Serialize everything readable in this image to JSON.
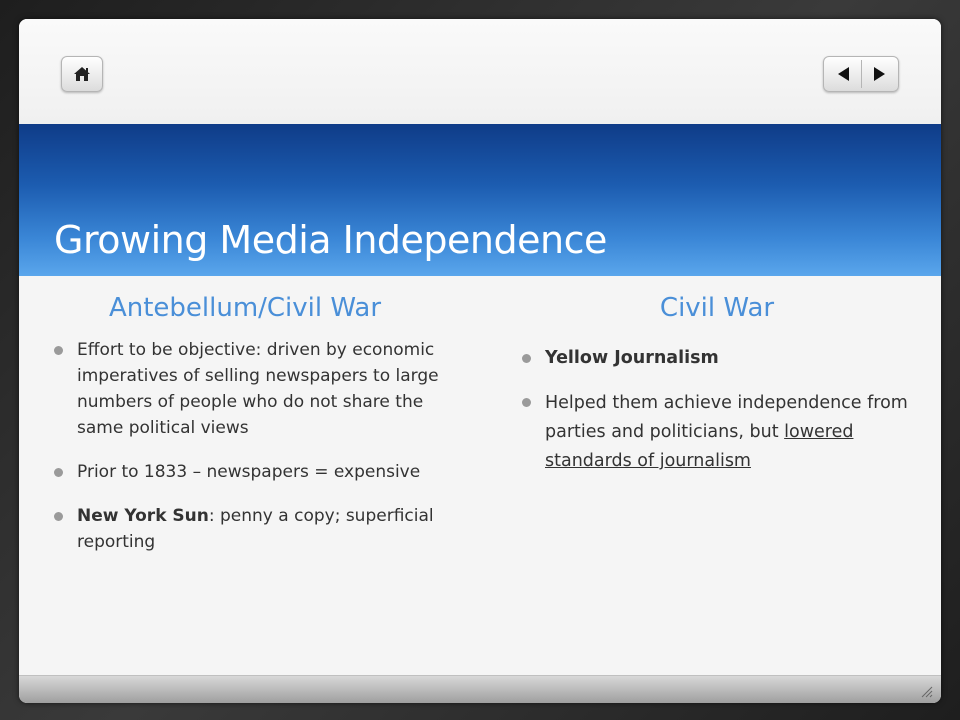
{
  "slide": {
    "title": "Growing Media Independence"
  },
  "nav": {
    "home_icon": "home-icon",
    "prev_icon": "triangle-left-icon",
    "next_icon": "triangle-right-icon"
  },
  "left_column": {
    "heading": "Antebellum/Civil War",
    "bullets": [
      {
        "text": "Effort to be objective: driven by economic imperatives of selling newspapers to large numbers of people who do not share the same political views"
      },
      {
        "text": "Prior to 1833 – newspapers = expensive"
      },
      {
        "bold": "New York Sun",
        "text": ": penny a copy; superficial reporting"
      }
    ]
  },
  "right_column": {
    "heading": "Civil War",
    "bullets": [
      {
        "bold": "Yellow Journalism"
      },
      {
        "text": "Helped them achieve independence from parties and politicians, but ",
        "underlined": "lowered standards of journalism"
      }
    ]
  },
  "colors": {
    "title_band_top": "#0f3c88",
    "title_band_bottom": "#5aa6ec",
    "heading": "#4a8fd8",
    "body_text": "#333333"
  }
}
